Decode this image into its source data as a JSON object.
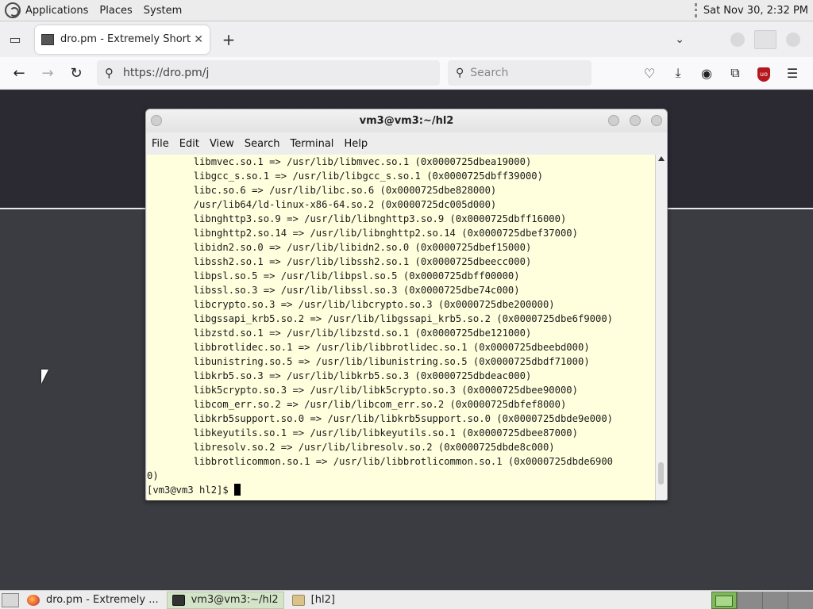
{
  "top_panel": {
    "menus": [
      "Applications",
      "Places",
      "System"
    ],
    "clock": "Sat Nov 30,  2:32 PM"
  },
  "browser": {
    "tab_title": "dro.pm - Extremely Short Li",
    "url": "https://dro.pm/j",
    "search_placeholder": "Search"
  },
  "terminal": {
    "title": "vm3@vm3:~/hl2",
    "menus": [
      "File",
      "Edit",
      "View",
      "Search",
      "Terminal",
      "Help"
    ],
    "lines": [
      "\tlibmvec.so.1 => /usr/lib/libmvec.so.1 (0x0000725dbea19000)",
      "\tlibgcc_s.so.1 => /usr/lib/libgcc_s.so.1 (0x0000725dbff39000)",
      "\tlibc.so.6 => /usr/lib/libc.so.6 (0x0000725dbe828000)",
      "\t/usr/lib64/ld-linux-x86-64.so.2 (0x0000725dc005d000)",
      "\tlibnghttp3.so.9 => /usr/lib/libnghttp3.so.9 (0x0000725dbff16000)",
      "\tlibnghttp2.so.14 => /usr/lib/libnghttp2.so.14 (0x0000725dbef37000)",
      "\tlibidn2.so.0 => /usr/lib/libidn2.so.0 (0x0000725dbef15000)",
      "\tlibssh2.so.1 => /usr/lib/libssh2.so.1 (0x0000725dbeecc000)",
      "\tlibpsl.so.5 => /usr/lib/libpsl.so.5 (0x0000725dbff00000)",
      "\tlibssl.so.3 => /usr/lib/libssl.so.3 (0x0000725dbe74c000)",
      "\tlibcrypto.so.3 => /usr/lib/libcrypto.so.3 (0x0000725dbe200000)",
      "\tlibgssapi_krb5.so.2 => /usr/lib/libgssapi_krb5.so.2 (0x0000725dbe6f9000)",
      "\tlibzstd.so.1 => /usr/lib/libzstd.so.1 (0x0000725dbe121000)",
      "\tlibbrotlidec.so.1 => /usr/lib/libbrotlidec.so.1 (0x0000725dbeebd000)",
      "\tlibunistring.so.5 => /usr/lib/libunistring.so.5 (0x0000725dbdf71000)",
      "\tlibkrb5.so.3 => /usr/lib/libkrb5.so.3 (0x0000725dbdeac000)",
      "\tlibk5crypto.so.3 => /usr/lib/libk5crypto.so.3 (0x0000725dbee90000)",
      "\tlibcom_err.so.2 => /usr/lib/libcom_err.so.2 (0x0000725dbfef8000)",
      "\tlibkrb5support.so.0 => /usr/lib/libkrb5support.so.0 (0x0000725dbde9e000)",
      "\tlibkeyutils.so.1 => /usr/lib/libkeyutils.so.1 (0x0000725dbee87000)",
      "\tlibresolv.so.2 => /usr/lib/libresolv.so.2 (0x0000725dbde8c000)",
      "\tlibbrotlicommon.so.1 => /usr/lib/libbrotlicommon.so.1 (0x0000725dbde6900",
      "0)"
    ],
    "prompt": "[vm3@vm3 hl2]$ "
  },
  "taskbar": {
    "tasks": [
      "dro.pm - Extremely ...",
      "vm3@vm3:~/hl2",
      "[hl2]"
    ]
  }
}
